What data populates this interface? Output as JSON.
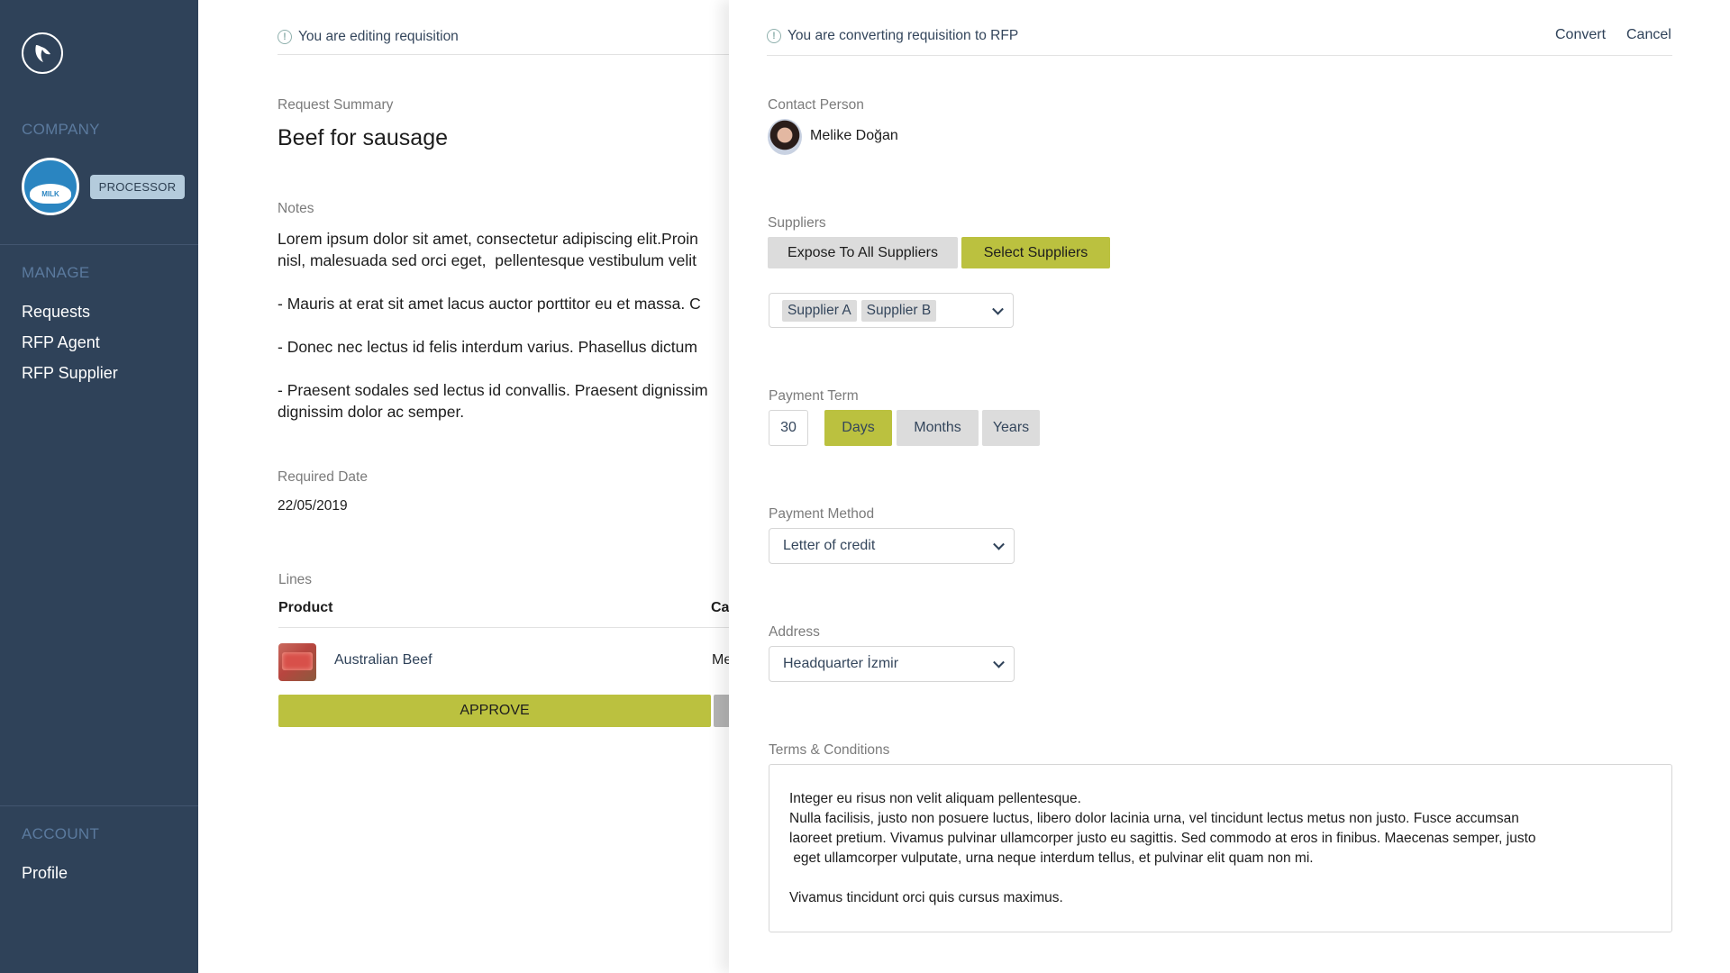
{
  "sidebar": {
    "logo_icon": "bird-logo-icon",
    "company_heading": "COMPANY",
    "company_logo_text": "MILK",
    "role_badge": "PROCESSOR",
    "manage_heading": "MANAGE",
    "manage_items": [
      {
        "label": "Requests"
      },
      {
        "label": "RFP Agent"
      },
      {
        "label": "RFP Supplier"
      }
    ],
    "account_heading": "ACCOUNT",
    "account_items": [
      {
        "label": "Profile"
      }
    ]
  },
  "requisition": {
    "info_text": "You are editing requisition",
    "summary_label": "Request Summary",
    "summary_title": "Beef for sausage",
    "notes_label": "Notes",
    "notes_text": "Lorem ipsum dolor sit amet, consectetur adipiscing elit.Proin\nnisl, malesuada sed orci eget,  pellentesque vestibulum velit\n\n- Mauris at erat sit amet lacus auctor porttitor eu et massa. C\n\n- Donec nec lectus id felis interdum varius. Phasellus dictum\n\n- Praesent sodales sed lectus id convallis. Praesent dignissim\ndignissim dolor ac semper.",
    "required_date_label": "Required Date",
    "required_date": "22/05/2019",
    "lines_label": "Lines",
    "columns": [
      "Product",
      "Ca"
    ],
    "lines": [
      {
        "product": "Australian Beef",
        "category": "Me"
      }
    ],
    "approve_label": "APPROVE"
  },
  "rfp_panel": {
    "info_text": "You are converting requisition to RFP",
    "convert_label": "Convert",
    "cancel_label": "Cancel",
    "contact_label": "Contact Person",
    "contact_name": "Melike Doğan",
    "suppliers_label": "Suppliers",
    "supplier_modes": [
      {
        "label": "Expose To All Suppliers",
        "selected": false
      },
      {
        "label": "Select Suppliers",
        "selected": true
      }
    ],
    "selected_suppliers": [
      "Supplier A",
      "Supplier B"
    ],
    "payment_term_label": "Payment Term",
    "payment_term_value": "30",
    "payment_term_units": [
      {
        "label": "Days",
        "selected": true
      },
      {
        "label": "Months",
        "selected": false
      },
      {
        "label": "Years",
        "selected": false
      }
    ],
    "payment_method_label": "Payment Method",
    "payment_method_value": "Letter of credit",
    "address_label": "Address",
    "address_value": "Headquarter İzmir",
    "terms_label": "Terms & Conditions",
    "terms_text": "Integer eu risus non velit aliquam pellentesque.\nNulla facilisis, justo non posuere luctus, libero dolor lacinia urna, vel tincidunt lectus metus non justo. Fusce accumsan\nlaoreet pretium. Vivamus pulvinar ullamcorper justo eu sagittis. Sed commodo at eros in finibus. Maecenas semper, justo\n eget ullamcorper vulputate, urna neque interdum tellus, et pulvinar elit quam non mi.\n\nVivamus tincidunt orci quis cursus maximus."
  },
  "colors": {
    "sidebar_bg": "#2f4259",
    "accent_green": "#bbc13f",
    "sidebar_heading": "#5b7a9e",
    "badge_bg": "#b4cbdc"
  }
}
